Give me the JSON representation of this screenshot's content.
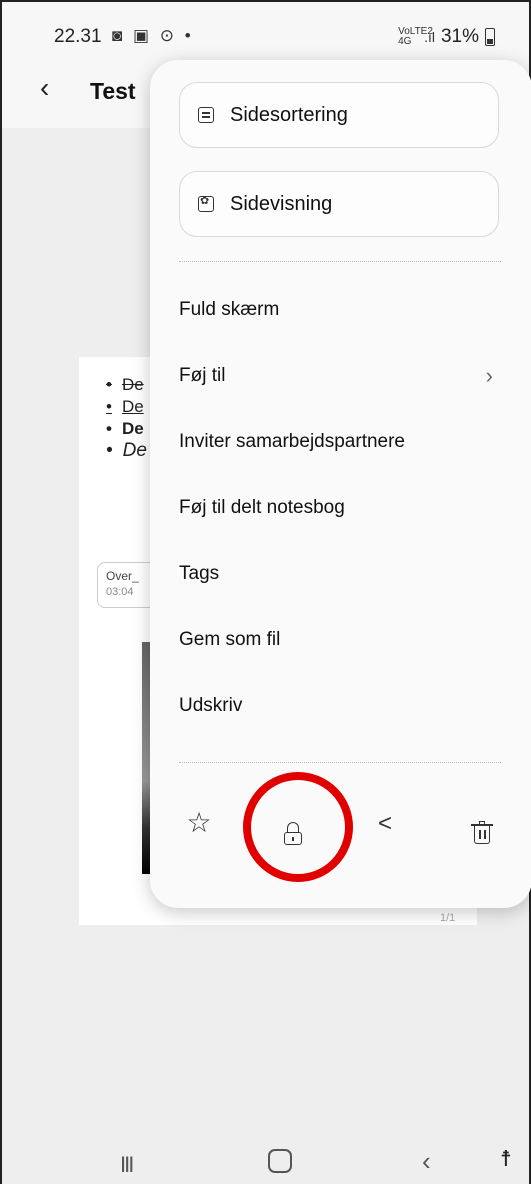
{
  "status_bar": {
    "time": "22.31",
    "left_icons": "◙ ▣ ⊙ •",
    "network": "VoLTE2 4G",
    "signal": ".ıl",
    "battery": "31%"
  },
  "header": {
    "back_icon": "‹",
    "title": "Test"
  },
  "note": {
    "bullets": [
      "De",
      "De",
      "De",
      "De"
    ],
    "attachment": {
      "name": "Over_",
      "time": "03:04"
    },
    "page_count": "1/1"
  },
  "menu": {
    "buttons": [
      {
        "label": "Sidesortering",
        "icon": "list-icon"
      },
      {
        "label": "Sidevisning",
        "icon": "settings-icon"
      }
    ],
    "items": [
      {
        "label": "Fuld skærm"
      },
      {
        "label": "Føj til",
        "has_submenu": true,
        "chevron": "›"
      },
      {
        "label": "Inviter samarbejdspartnere"
      },
      {
        "label": "Føj til delt notesbog"
      },
      {
        "label": "Tags"
      },
      {
        "label": "Gem som fil"
      },
      {
        "label": "Udskriv"
      }
    ],
    "actions": {
      "favorite": "☆",
      "share": "<"
    }
  },
  "highlight_color": "#e00000",
  "nav_bar": {
    "recent": "III",
    "back": "‹",
    "accessibility": "☨"
  }
}
